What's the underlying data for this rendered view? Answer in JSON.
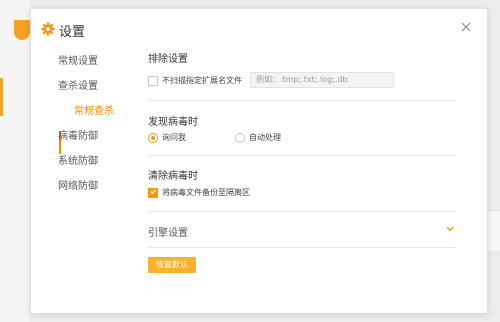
{
  "dialog": {
    "title": "设置",
    "close_icon": "close-icon",
    "gear_icon": "gear-icon"
  },
  "nav": {
    "items": [
      {
        "label": "常规设置",
        "active": false
      },
      {
        "label": "查杀设置",
        "active": false
      },
      {
        "label": "常规查杀",
        "active": true
      },
      {
        "label": "病毒防御",
        "active": false
      },
      {
        "label": "系统防御",
        "active": false
      },
      {
        "label": "网络防御",
        "active": false
      }
    ]
  },
  "exclude": {
    "title": "排除设置",
    "checkbox_label": "不扫描指定扩展名文件",
    "checkbox_checked": false,
    "input_placeholder": "例如：.tmp;.txt;.log;.db"
  },
  "virus_found": {
    "title": "发现病毒时",
    "options": [
      {
        "label": "询问我",
        "selected": true
      },
      {
        "label": "自动处理",
        "selected": false
      }
    ]
  },
  "clean_virus": {
    "title": "清除病毒时",
    "checkbox_label": "将病毒文件备份至隔离区",
    "checkbox_checked": true
  },
  "engine": {
    "label": "引擎设置",
    "chevron_icon": "chevron-down-icon"
  },
  "restore_button": "恢复默认",
  "colors": {
    "accent": "#f08a00",
    "button": "#f7b030"
  }
}
